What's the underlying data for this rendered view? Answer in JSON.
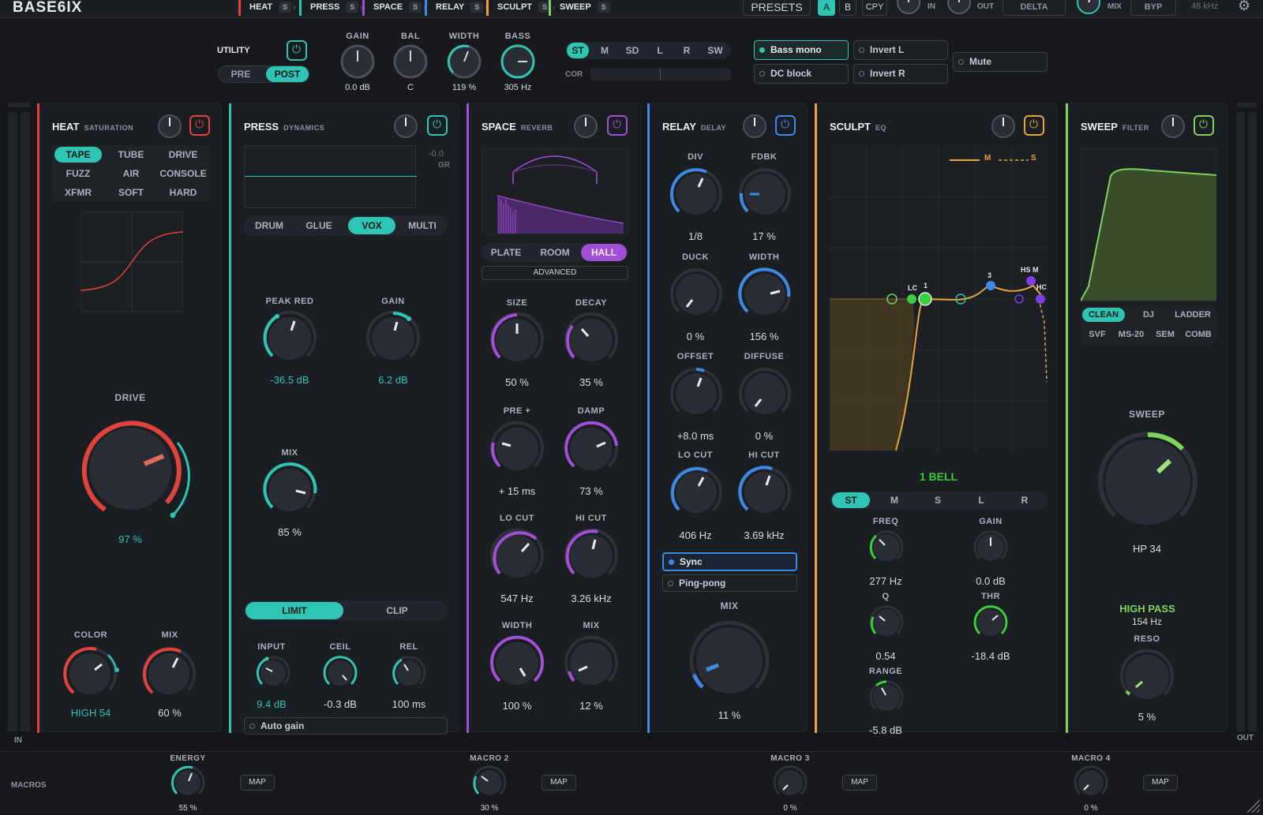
{
  "app": {
    "title": "BASE6IX",
    "sample_rate": "48 kHz"
  },
  "modules": [
    {
      "name": "HEAT",
      "badge": "S",
      "color": "#e0433b"
    },
    {
      "name": "PRESS",
      "badge": "S",
      "color": "#2fc4b4"
    },
    {
      "name": "SPACE",
      "badge": "S",
      "color": "#a24fd8"
    },
    {
      "name": "RELAY",
      "badge": "S",
      "color": "#3d8ae6"
    },
    {
      "name": "SCULPT",
      "badge": "S",
      "color": "#e7a43a"
    },
    {
      "name": "SWEEP",
      "badge": "S",
      "color": "#7ed35b"
    }
  ],
  "top": {
    "presets": "PRESETS",
    "a": "A",
    "b": "B",
    "copy": "CPY",
    "in": "IN",
    "out": "OUT",
    "delta": "DELTA",
    "mix": "MIX",
    "byp": "BYP"
  },
  "utility": {
    "label": "UTILITY",
    "pre": "PRE",
    "post": "POST",
    "gain_label": "GAIN",
    "gain": "0.0 dB",
    "bal_label": "BAL",
    "bal": "C",
    "width_label": "WIDTH",
    "width": "119 %",
    "bass_label": "BASS",
    "bass": "305 Hz",
    "modes": [
      "ST",
      "M",
      "SD",
      "L",
      "R",
      "SW"
    ],
    "cor": "COR",
    "bass_mono": "Bass mono",
    "invert_l": "Invert L",
    "mute": "Mute",
    "dc_block": "DC block",
    "invert_r": "Invert R"
  },
  "heat": {
    "title": "HEAT",
    "sub": "SATURATION",
    "types": [
      "TAPE",
      "TUBE",
      "DRIVE",
      "FUZZ",
      "AIR",
      "CONSOLE",
      "XFMR",
      "SOFT",
      "HARD"
    ],
    "drive_label": "DRIVE",
    "drive": "97 %",
    "color_label": "COLOR",
    "color_val": "HIGH 54",
    "mix_label": "MIX",
    "mix": "60 %",
    "drive_level": 0.97
  },
  "press": {
    "title": "PRESS",
    "sub": "DYNAMICS",
    "gr_val": "-0.0",
    "gr": "GR",
    "modes": [
      "DRUM",
      "GLUE",
      "VOX",
      "MULTI"
    ],
    "peak_label": "PEAK RED",
    "peak": "-36.5 dB",
    "gain_label": "GAIN",
    "gain": "6.2 dB",
    "mix_label": "MIX",
    "mix": "85 %",
    "limit": "LIMIT",
    "clip": "CLIP",
    "input_label": "INPUT",
    "input": "9.4 dB",
    "ceil_label": "CEIL",
    "ceil": "-0.3 dB",
    "rel_label": "REL",
    "rel": "100 ms",
    "auto_gain": "Auto gain"
  },
  "space": {
    "title": "SPACE",
    "sub": "REVERB",
    "types": [
      "PLATE",
      "ROOM",
      "HALL"
    ],
    "advanced": "ADVANCED",
    "size_label": "SIZE",
    "size": "50 %",
    "decay_label": "DECAY",
    "decay": "35 %",
    "pre_label": "PRE +",
    "pre": "+ 15 ms",
    "damp_label": "DAMP",
    "damp": "73 %",
    "locut_label": "LO CUT",
    "locut": "547 Hz",
    "hicut_label": "HI CUT",
    "hicut": "3.26 kHz",
    "width_label": "WIDTH",
    "width": "100 %",
    "mix_label": "MIX",
    "mix": "12 %"
  },
  "relay": {
    "title": "RELAY",
    "sub": "DELAY",
    "div_label": "DIV",
    "div": "1/8",
    "fdbk_label": "FDBK",
    "fdbk": "17 %",
    "duck_label": "DUCK",
    "duck": "0 %",
    "width_label": "WIDTH",
    "width": "156 %",
    "offset_label": "OFFSET",
    "offset": "+8.0 ms",
    "diffuse_label": "DIFFUSE",
    "diffuse": "0 %",
    "locut_label": "LO CUT",
    "locut": "406 Hz",
    "hicut_label": "HI CUT",
    "hicut": "3.69 kHz",
    "sync": "Sync",
    "pingpong": "Ping-pong",
    "mix_label": "MIX",
    "mix": "11 %"
  },
  "sculpt": {
    "title": "SCULPT",
    "sub": "EQ",
    "legend_m": "M",
    "legend_s": "S",
    "band": "1  BELL",
    "node_labels": [
      "LC",
      "1",
      "3",
      "HS M",
      "HC"
    ],
    "modes": [
      "ST",
      "M",
      "S",
      "L",
      "R"
    ],
    "freq_label": "FREQ",
    "freq": "277 Hz",
    "gain_label": "GAIN",
    "gain": "0.0 dB",
    "q_label": "Q",
    "q": "0.54",
    "thr_label": "THR",
    "thr": "-18.4 dB",
    "range_label": "RANGE",
    "range": "-5.8 dB"
  },
  "sweep": {
    "title": "SWEEP",
    "sub": "FILTER",
    "types": [
      "CLEAN",
      "DJ",
      "LADDER",
      "SVF",
      "MS-20",
      "SEM",
      "COMB"
    ],
    "sweep_label": "SWEEP",
    "sweep_val": "HP 34",
    "mode": "HIGH PASS",
    "freq": "154 Hz",
    "reso_label": "RESO",
    "reso": "5 %"
  },
  "meters": {
    "in": "IN",
    "out": "OUT"
  },
  "macros": {
    "label": "MACROS",
    "items": [
      {
        "name": "ENERGY",
        "value": "55 %",
        "map": "MAP"
      },
      {
        "name": "MACRO 2",
        "value": "30 %",
        "map": "MAP"
      },
      {
        "name": "MACRO 3",
        "value": "0 %",
        "map": "MAP"
      },
      {
        "name": "MACRO 4",
        "value": "0 %",
        "map": "MAP"
      }
    ]
  }
}
